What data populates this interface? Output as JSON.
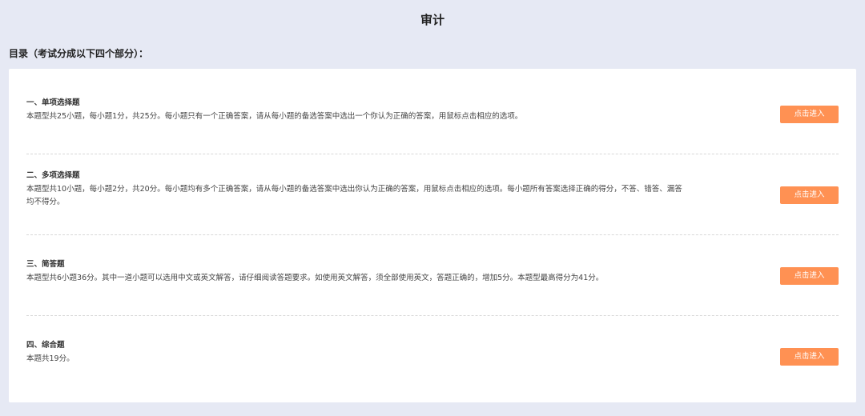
{
  "page": {
    "title": "审计",
    "toc_heading": "目录（考试分成以下四个部分）："
  },
  "sections": [
    {
      "title": "一、单项选择题",
      "description": "本题型共25小题，每小题1分，共25分。每小题只有一个正确答案，请从每小题的备选答案中选出一个你认为正确的答案，用鼠标点击相应的选项。",
      "button_label": "点击进入"
    },
    {
      "title": "二、多项选择题",
      "description": "本题型共10小题，每小题2分，共20分。每小题均有多个正确答案，请从每小题的备选答案中选出你认为正确的答案，用鼠标点击相应的选项。每小题所有答案选择正确的得分，不答、错答、漏答均不得分。",
      "button_label": "点击进入"
    },
    {
      "title": "三、简答题",
      "description": "本题型共6小题36分。其中一道小题可以选用中文或英文解答，请仔细阅读答题要求。如使用英文解答，须全部使用英文，答题正确的，增加5分。本题型最高得分为41分。",
      "button_label": "点击进入"
    },
    {
      "title": "四、综合题",
      "description": "本题共19分。",
      "button_label": "点击进入"
    }
  ],
  "colors": {
    "background": "#e6e9f4",
    "card": "#ffffff",
    "button": "#ff9153",
    "divider": "#d8d8d8"
  }
}
